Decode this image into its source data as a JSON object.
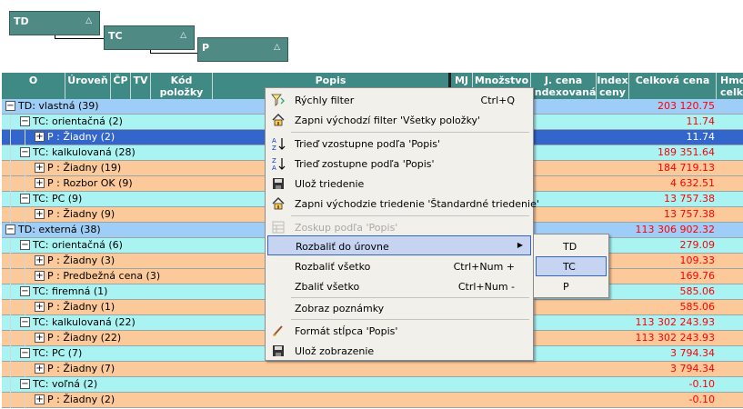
{
  "group_by": [
    {
      "label": "TD",
      "arrow": "△"
    },
    {
      "label": "TC",
      "arrow": "△"
    },
    {
      "label": "P",
      "arrow": "△"
    }
  ],
  "columns": [
    {
      "label": "O"
    },
    {
      "label": "Úroveň"
    },
    {
      "label": "ČP"
    },
    {
      "label": "TV"
    },
    {
      "label": "Kód položky"
    },
    {
      "label": "Popis"
    },
    {
      "label": "MJ"
    },
    {
      "label": "Množstvo"
    },
    {
      "label": "J. cena indexovaná"
    },
    {
      "label": "Index ceny"
    },
    {
      "label": "Celková cena"
    },
    {
      "label": "Hmot. celk"
    }
  ],
  "rows": [
    {
      "level": "td",
      "expander": "−",
      "label": "TD: vlastná  (39)",
      "amount": "203 120.75"
    },
    {
      "level": "tc",
      "expander": "−",
      "label": "TC: orientačná  (2)",
      "amount": "11.74"
    },
    {
      "level": "p",
      "expander": "+",
      "label": "P : Žiadny  (2)",
      "amount": "11.74",
      "selected": true
    },
    {
      "level": "tc",
      "expander": "−",
      "label": "TC: kalkulovaná  (28)",
      "amount": "189 351.64"
    },
    {
      "level": "p",
      "expander": "+",
      "label": "P : Žiadny  (19)",
      "amount": "184 719.13"
    },
    {
      "level": "p",
      "expander": "+",
      "label": "P : Rozbor OK  (9)",
      "amount": "4 632.51"
    },
    {
      "level": "tc",
      "expander": "−",
      "label": "TC: PC  (9)",
      "amount": "13 757.38"
    },
    {
      "level": "p",
      "expander": "+",
      "label": "P : Žiadny  (9)",
      "amount": "13 757.38"
    },
    {
      "level": "td",
      "expander": "−",
      "label": "TD: externá  (38)",
      "amount": "113 306 902.32"
    },
    {
      "level": "tc",
      "expander": "−",
      "label": "TC: orientačná  (6)",
      "amount": "279.09"
    },
    {
      "level": "p",
      "expander": "+",
      "label": "P : Žiadny  (3)",
      "amount": "109.33"
    },
    {
      "level": "p",
      "expander": "+",
      "label": "P : Predbežná cena  (3)",
      "amount": "169.76"
    },
    {
      "level": "tc",
      "expander": "−",
      "label": "TC: firemná  (1)",
      "amount": "585.06"
    },
    {
      "level": "p",
      "expander": "+",
      "label": "P : Žiadny  (1)",
      "amount": "585.06"
    },
    {
      "level": "tc",
      "expander": "−",
      "label": "TC: kalkulovaná  (22)",
      "amount": "113 302 243.93"
    },
    {
      "level": "p",
      "expander": "+",
      "label": "P : Žiadny  (22)",
      "amount": "113 302 243.93"
    },
    {
      "level": "tc",
      "expander": "−",
      "label": "TC: PC  (7)",
      "amount": "3 794.34"
    },
    {
      "level": "p",
      "expander": "+",
      "label": "P : Žiadny  (7)",
      "amount": "3 794.34"
    },
    {
      "level": "tc",
      "expander": "−",
      "label": "TC: voľná  (2)",
      "amount": "-0.10"
    },
    {
      "level": "p",
      "expander": "+",
      "label": "P : Žiadny  (2)",
      "amount": "-0.10"
    }
  ],
  "context_menu": {
    "items": [
      {
        "icon": "quick-filter-icon",
        "label": "Rýchly filter",
        "shortcut": "Ctrl+Q"
      },
      {
        "icon": "home-filter-icon",
        "label": "Zapni východzí filter 'Všetky položky'",
        "shortcut": ""
      },
      {
        "icon": "sort-ascending-icon",
        "label": "Trieď vzostupne podľa 'Popis'",
        "shortcut": ""
      },
      {
        "icon": "sort-descending-icon",
        "label": "Trieď zostupne podľa 'Popis'",
        "shortcut": ""
      },
      {
        "icon": "save-disk-icon",
        "label": "Ulož triedenie",
        "shortcut": ""
      },
      {
        "icon": "home-sort-icon",
        "label": "Zapni východzie triedenie 'Štandardné triedenie'",
        "shortcut": ""
      },
      {
        "icon": "group-icon",
        "label": "Zoskup podľa 'Popis'",
        "shortcut": "",
        "disabled": true
      },
      {
        "icon": "",
        "label": "Rozbaliť do úrovne",
        "shortcut": "",
        "submenu": true,
        "highlighted": true
      },
      {
        "icon": "",
        "label": "Rozbaliť všetko",
        "shortcut": "Ctrl+Num +"
      },
      {
        "icon": "",
        "label": "Zbaliť všetko",
        "shortcut": "Ctrl+Num -"
      },
      {
        "icon": "",
        "label": "Zobraz poznámky",
        "shortcut": ""
      },
      {
        "icon": "brush-icon",
        "label": "Formát stĺpca 'Popis'",
        "shortcut": ""
      },
      {
        "icon": "save-disk-icon",
        "label": "Ulož zobrazenie",
        "shortcut": ""
      }
    ],
    "submenu": [
      {
        "label": "TD"
      },
      {
        "label": "TC",
        "highlighted": true
      },
      {
        "label": "P"
      }
    ]
  },
  "colors": {
    "header": "#3f8a84",
    "td_row": "#9ecdf7",
    "tc_row": "#a9f3f3",
    "p_row": "#fcc99a",
    "selected_row": "#3366cc",
    "amount": "#ff0000"
  }
}
